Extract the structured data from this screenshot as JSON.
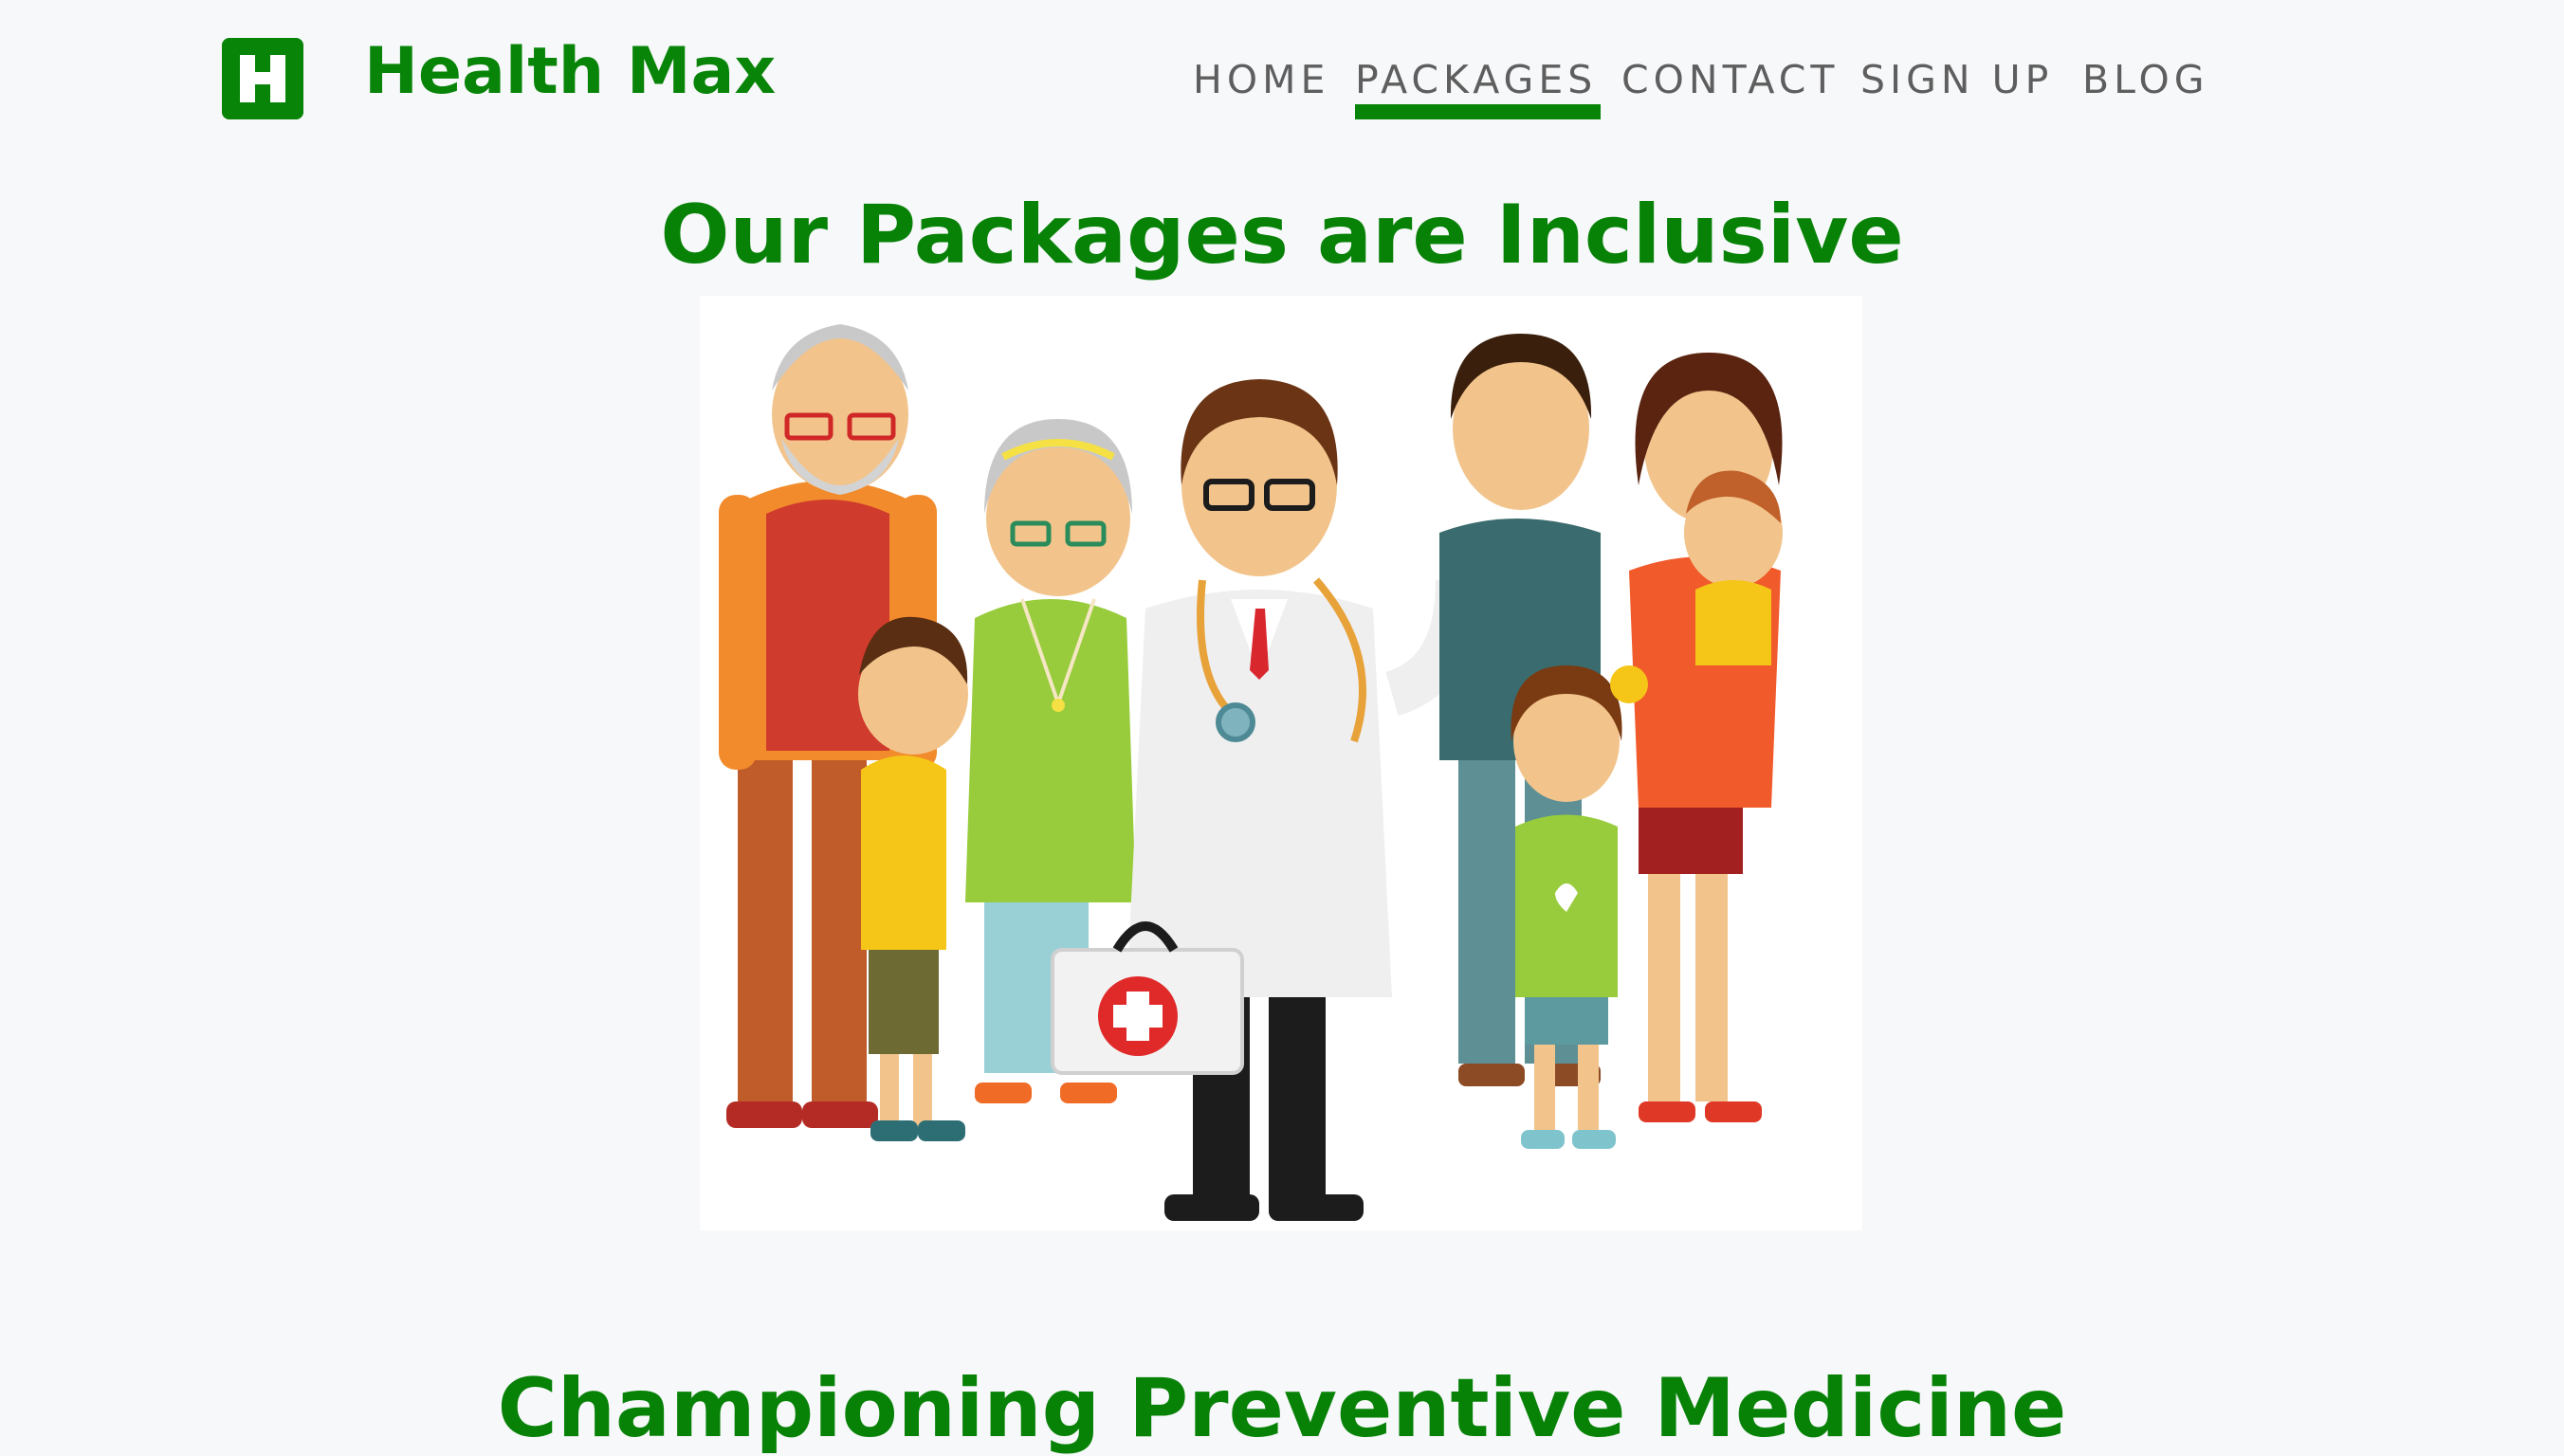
{
  "header": {
    "logo_letter": "H",
    "brand_name": "Health Max",
    "nav": [
      {
        "label": "HOME",
        "active": false
      },
      {
        "label": "PACKAGES",
        "active": true
      },
      {
        "label": "CONTACT",
        "active": false
      },
      {
        "label": "SIGN UP",
        "active": false
      },
      {
        "label": "BLOG",
        "active": false
      }
    ]
  },
  "main": {
    "section_title": "Our Packages are Inclusive",
    "next_section_title": "Championing Preventive Medicine"
  },
  "colors": {
    "brand_green": "#088408",
    "nav_text": "#5e5e5e",
    "background": "#f7f8fa"
  }
}
